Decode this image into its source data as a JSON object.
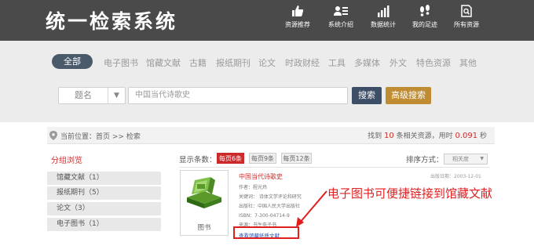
{
  "app": {
    "title": "统一检索系统"
  },
  "nav": [
    {
      "label": "资源推荐",
      "icon": "thumbs-up-icon"
    },
    {
      "label": "系统介绍",
      "icon": "contact-card-icon"
    },
    {
      "label": "数据统计",
      "icon": "bar-chart-icon"
    },
    {
      "label": "我的足迹",
      "icon": "footprints-icon"
    },
    {
      "label": "所有资源",
      "icon": "document-search-icon"
    }
  ],
  "categories": {
    "active": "全部",
    "items": [
      "电子图书",
      "馆藏文献",
      "古籍",
      "报纸期刊",
      "论文",
      "时政财经",
      "工具",
      "多媒体",
      "外文",
      "特色资源",
      "其他"
    ]
  },
  "search": {
    "type_label": "题名",
    "query": "中国当代诗歌史",
    "search_button": "搜索",
    "advanced_button": "高级搜索"
  },
  "location": {
    "prefix": "当前位置：",
    "home": "首页",
    "sep": ">>",
    "current": "检索",
    "stats_found_pre": "找到",
    "stats_count": "10",
    "stats_found_post": "条相关资源，用时",
    "stats_time": "0.091",
    "stats_unit": "秒"
  },
  "grouping": {
    "title": "分组浏览",
    "items": [
      "馆藏文献（1）",
      "报纸期刊（5）",
      "论文（3）",
      "电子图书（1）"
    ]
  },
  "display": {
    "label": "显示条数：",
    "options": [
      "每页6条",
      "每页9条",
      "每页12条"
    ],
    "active_index": 0,
    "sort_label": "排序方式：",
    "sort_value": "相关度"
  },
  "result": {
    "title": "中国当代诗歌史",
    "date": "出版日期：2003-12-01",
    "author": "作者：程光炜",
    "keywords": "关键词：   诗体文学评论和研究",
    "publisher": "出版社：中国人民大学出版社",
    "isbn": "ISBN：7-300-04714-9",
    "source": "来源：书生电子书",
    "thumb_caption": "图书",
    "link": "查看馆藏纸质文献"
  },
  "annotation": {
    "text": "电子图书可便捷链接到馆藏文献"
  },
  "colors": {
    "header_bg": "#4a4a4a",
    "active_red": "#cc2a2a",
    "search_btn": "#3c4f66",
    "advanced_btn": "#bf8c34"
  }
}
